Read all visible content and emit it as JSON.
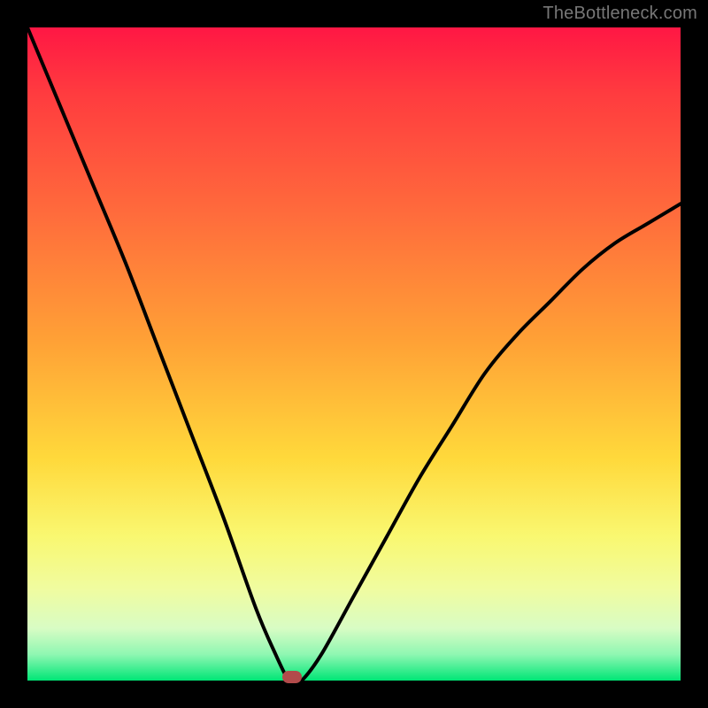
{
  "watermark": "TheBottleneck.com",
  "chart_data": {
    "type": "line",
    "title": "",
    "xlabel": "",
    "ylabel": "",
    "x": [
      0.0,
      0.05,
      0.1,
      0.15,
      0.2,
      0.25,
      0.3,
      0.35,
      0.38,
      0.4,
      0.41,
      0.42,
      0.45,
      0.5,
      0.55,
      0.6,
      0.65,
      0.7,
      0.75,
      0.8,
      0.85,
      0.9,
      0.95,
      1.0
    ],
    "values": [
      1.0,
      0.88,
      0.76,
      0.64,
      0.51,
      0.38,
      0.25,
      0.11,
      0.04,
      0.0,
      0.0,
      0.0,
      0.04,
      0.13,
      0.22,
      0.31,
      0.39,
      0.47,
      0.53,
      0.58,
      0.63,
      0.67,
      0.7,
      0.73
    ],
    "xlim": [
      0,
      1
    ],
    "ylim": [
      0,
      1
    ],
    "marker": {
      "x": 0.405,
      "y": 0.0
    },
    "notes": "Axes are normalized 0–1; the plot has no visible tick labels. Values are estimated from the rendered curve."
  },
  "colors": {
    "gradient_top": "#ff1744",
    "gradient_bottom": "#00e676",
    "curve": "#000000",
    "marker": "#b24b4b",
    "frame": "#000000"
  }
}
